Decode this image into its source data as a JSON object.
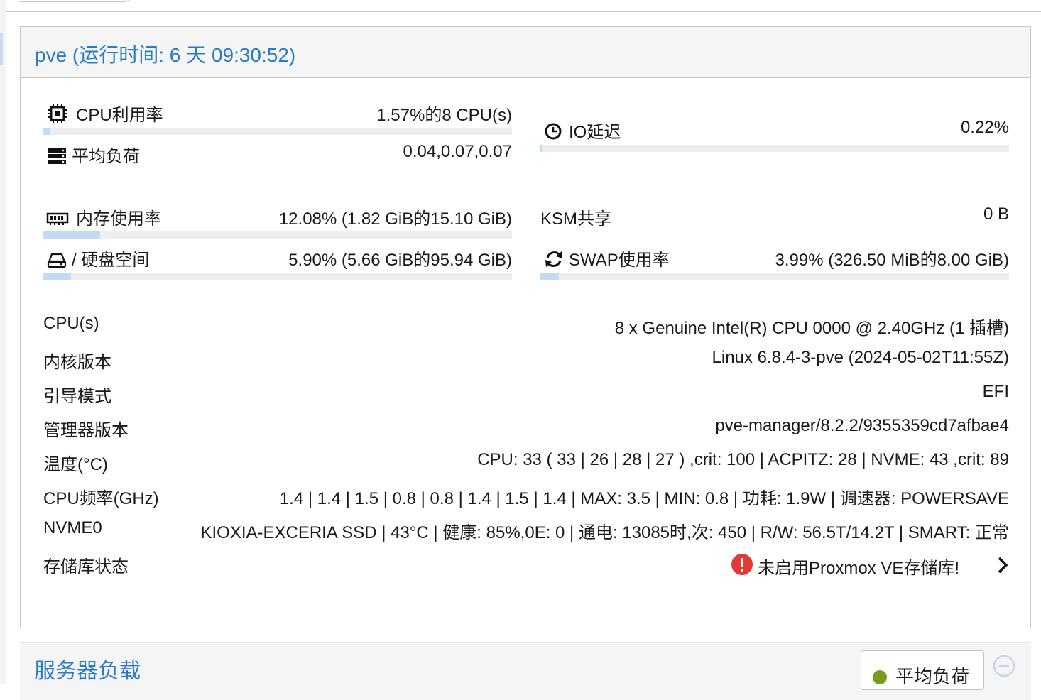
{
  "node": {
    "title": "pve (运行时间: 6 天 09:30:52)"
  },
  "metrics": {
    "cpu": {
      "label": "CPU利用率",
      "value": "1.57%的8 CPU(s)",
      "fraction": 0.0157,
      "icon": "cpu-chip-icon"
    },
    "load": {
      "label": "平均负荷",
      "value": "0.04,0.07,0.07",
      "icon": "server-stack-icon"
    },
    "io_delay": {
      "label": "IO延迟",
      "value": "0.22%",
      "fraction": 0.0022,
      "icon": "clock-icon"
    },
    "memory": {
      "label": "内存使用率",
      "value": "12.08% (1.82 GiB的15.10 GiB)",
      "fraction": 0.1208,
      "icon": "memory-stick-icon"
    },
    "ksm": {
      "label": "KSM共享",
      "value": "0 B"
    },
    "disk": {
      "label": "/ 硬盘空间",
      "value": "5.90% (5.66 GiB的95.94 GiB)",
      "fraction": 0.059,
      "icon": "hard-drive-icon"
    },
    "swap": {
      "label": "SWAP使用率",
      "value": "3.99% (326.50 MiB的8.00 GiB)",
      "fraction": 0.0399,
      "icon": "refresh-icon"
    }
  },
  "info": {
    "cpus": {
      "k": "CPU(s)",
      "v": "8 x Genuine Intel(R) CPU 0000 @ 2.40GHz (1 插槽)"
    },
    "kernel": {
      "k": "内核版本",
      "v": "Linux 6.8.4-3-pve (2024-05-02T11:55Z)"
    },
    "boot": {
      "k": "引导模式",
      "v": "EFI"
    },
    "manager": {
      "k": "管理器版本",
      "v": "pve-manager/8.2.2/9355359cd7afbae4"
    },
    "temp": {
      "k": "温度(°C)",
      "v": "CPU: 33 ( 33 | 26 | 28 | 27 ) ,crit: 100 | ACPITZ: 28 | NVME: 43 ,crit: 89"
    },
    "freq": {
      "k": "CPU频率(GHz)",
      "v": "1.4 | 1.4 | 1.5 | 0.8 | 0.8 | 1.4 | 1.5 | 1.4 | MAX: 3.5 | MIN: 0.8 | 功耗: 1.9W | 调速器: POWERSAVE"
    },
    "nvme": {
      "k": "NVME0",
      "v": "KIOXIA-EXCERIA SSD | 43°C | 健康: 85%,0E: 0 | 通电: 13085时,次: 450 | R/W: 56.5T/14.2T | SMART: 正常"
    },
    "repo": {
      "k": "存储库状态",
      "v": "未启用Proxmox VE存储库!"
    }
  },
  "server_load": {
    "title": "服务器负载",
    "legend_label": "平均负荷",
    "legend_color": "#7a9b1e"
  },
  "colors": {
    "accent": "#2b7ac6",
    "bar_fill": "#c2dbf2",
    "warning": "#e53935"
  }
}
